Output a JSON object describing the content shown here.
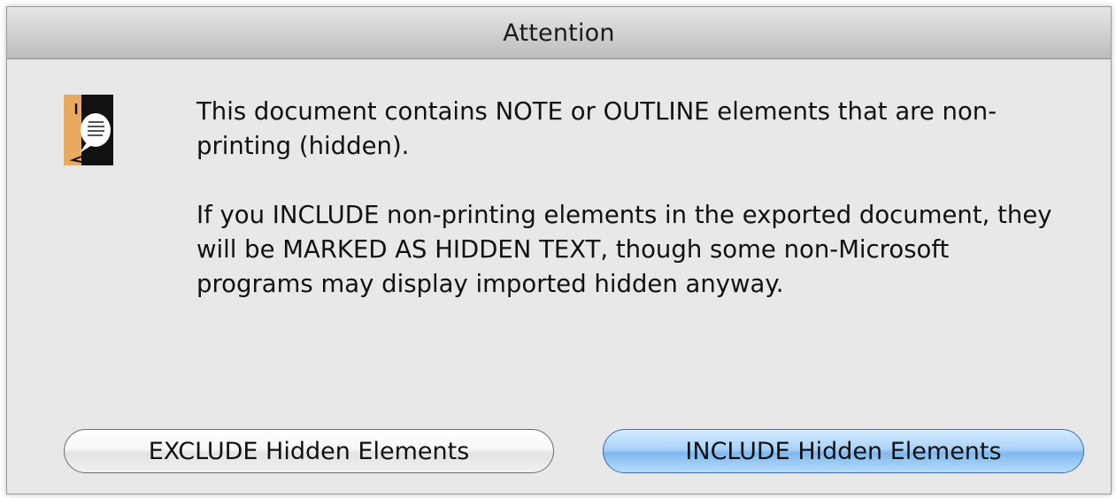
{
  "dialog": {
    "title": "Attention",
    "icon": "app-speech-bubble-icon",
    "message": {
      "paragraph1": "This document contains NOTE or OUTLINE elements that are non-printing (hidden).",
      "paragraph2": "If you INCLUDE non-printing elements in the exported document, they will be MARKED AS HIDDEN TEXT, though some non-Microsoft programs may display imported hidden anyway."
    },
    "buttons": {
      "exclude_label": "EXCLUDE Hidden Elements",
      "include_label": "INCLUDE Hidden Elements"
    }
  },
  "colors": {
    "dialog_background": "#e8e8e8",
    "default_button": "#8fc4f2"
  }
}
